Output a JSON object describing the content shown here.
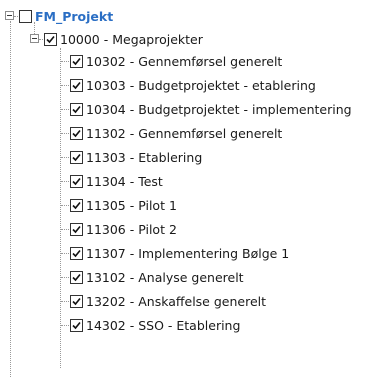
{
  "tree": {
    "root": {
      "label": "FM_Projekt",
      "checked": false,
      "expanded": true
    },
    "group": {
      "label": "10000 - Megaprojekter",
      "checked": true,
      "expanded": true
    },
    "children": [
      {
        "label": "10302 - Gennemførsel generelt",
        "checked": true
      },
      {
        "label": "10303 - Budgetprojektet - etablering",
        "checked": true
      },
      {
        "label": "10304 - Budgetprojektet - implementering",
        "checked": true
      },
      {
        "label": "11302 - Gennemførsel generelt",
        "checked": true
      },
      {
        "label": "11303 - Etablering",
        "checked": true
      },
      {
        "label": "11304 - Test",
        "checked": true
      },
      {
        "label": "11305 - Pilot 1",
        "checked": true
      },
      {
        "label": "11306 - Pilot 2",
        "checked": true
      },
      {
        "label": "11307 - Implementering Bølge 1",
        "checked": true
      },
      {
        "label": "13102 - Analyse generelt",
        "checked": true
      },
      {
        "label": "13202 - Anskaffelse generelt",
        "checked": true
      },
      {
        "label": "14302 - SSO - Etablering",
        "checked": true
      }
    ]
  },
  "colors": {
    "root_label": "#2a6ec4",
    "text": "#1a1a1a",
    "tree_lines": "#9a9a9a"
  }
}
